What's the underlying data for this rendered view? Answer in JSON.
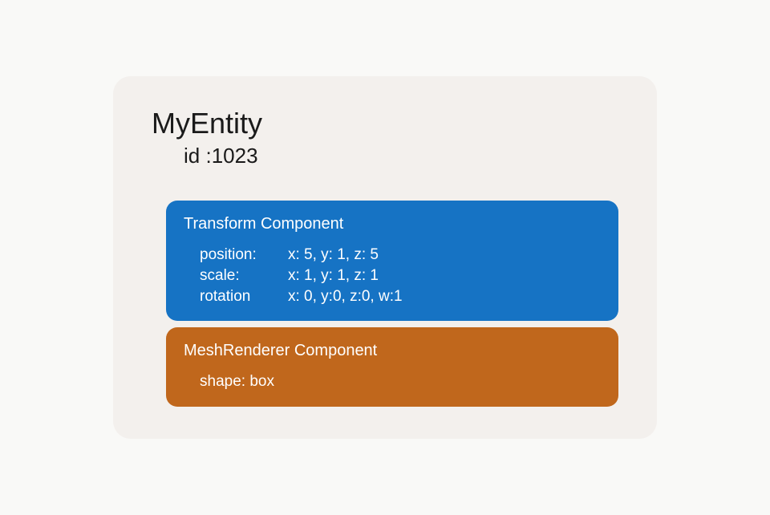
{
  "entity": {
    "name": "MyEntity",
    "id_label": "id :",
    "id_value": "1023",
    "components": {
      "transform": {
        "title": "Transform Component",
        "props": {
          "position": {
            "label": "position:",
            "value": "x: 5, y: 1, z: 5"
          },
          "scale": {
            "label": "scale:",
            "value": "x: 1, y: 1, z: 1"
          },
          "rotation": {
            "label": "rotation",
            "value": "x: 0, y:0, z:0, w:1"
          }
        }
      },
      "meshrenderer": {
        "title": "MeshRenderer Component",
        "props": {
          "shape": {
            "label": "shape: box"
          }
        }
      }
    }
  }
}
